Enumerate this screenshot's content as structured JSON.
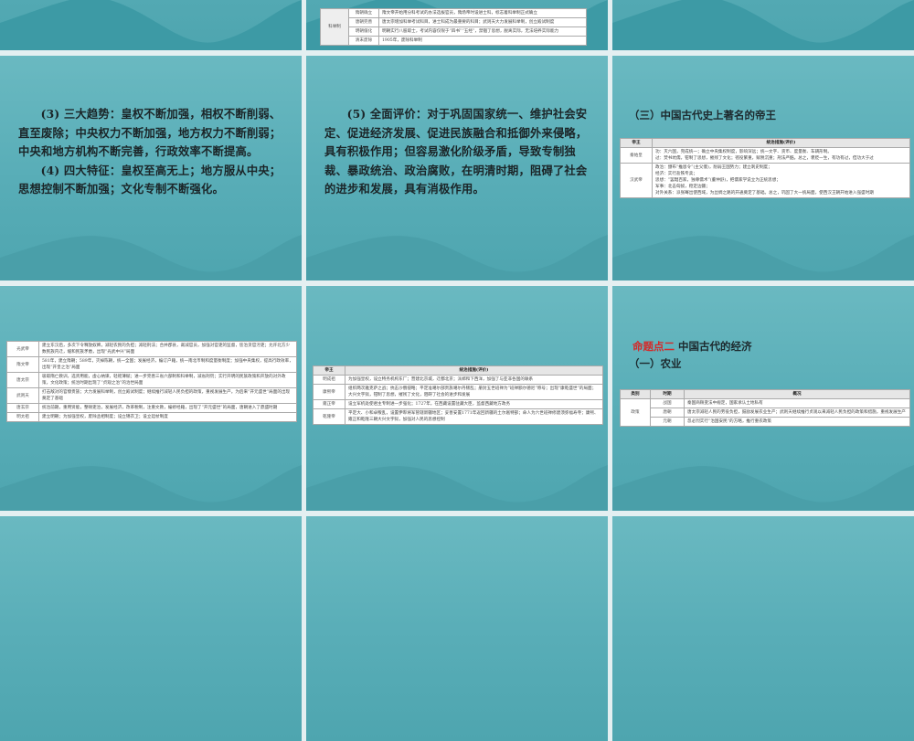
{
  "slides_top": {
    "middle_table": {
      "rows": [
        {
          "group": "科举制",
          "period": "隋朝确立",
          "text": "隋文帝开始用分科考试的办法选拔官员，隋炀帝时设进士科，标志着科举制正式确立"
        },
        {
          "period": "唐朝完善",
          "text": "唐太宗增加科举考试科目，进士科成为最重要的科目；武则天大力发展科举制，创立殿试制度"
        },
        {
          "period": "明朝僵化",
          "text": "明朝实行八股取士，考试内容仅限于“四书”“五经”，禁锢了思想，脱离实际，无法培养实际能力"
        },
        {
          "period": "清末废除",
          "text": "1905年，废除科举制"
        }
      ]
    }
  },
  "slide_trends": {
    "paragraphs": [
      "(3) 三大趋势：皇权不断加强，相权不断削弱、直至废除；中央权力不断加强，地方权力不断削弱；中央和地方机构不断完善，行政效率不断提高。",
      "(4) 四大特征：皇权至高无上；地方服从中央；思想控制不断加强；文化专制不断强化。"
    ]
  },
  "slide_evaluation": {
    "paragraphs": [
      "(5) 全面评价：对于巩固国家统一、维护社会安定、促进经济发展、促进民族融合和抵御外来侵略，具有积极作用；但容易激化阶级矛盾，导致专制独裁、暴政统治、政治腐败，在明清时期，阻碍了社会的进步和发展，具有消极作用。"
    ]
  },
  "slide_emperors": {
    "heading": "（三）中国古代史上著名的帝王",
    "headers": [
      "帝王",
      "统治措施(评价)"
    ],
    "rows": [
      {
        "name": "秦始皇",
        "lines": [
          "功：灭六国，完成统一；确立中央集权制度，影响深远；统一文字、货币、度量衡、车辆形制。",
          "过：焚书坑儒，钳制了思想，摧残了文化；徭役繁重，赋税沉重；刑法严酷。总之，褒贬一生，有功有过，但功大于过"
        ]
      },
      {
        "name": "汉武帝",
        "lines": [
          "政治：颁布“推恩令”(主父偃)，削弱王国势力；建立刺史制度；",
          "经济：实行盐铁专卖；",
          "思想：“罢黜百家，独尊儒术”(董仲舒)，把儒家学说立为正统思想；",
          "军事：北击匈奴，稳定边疆；",
          "对外关系：派张骞出使西域，为丝绸之路的开通奠定了基础。总之，巩固了大一统局面，使西汉王朝开始进入强盛时期"
        ]
      }
    ]
  },
  "slide_emperors2": {
    "rows": [
      {
        "name": "光武帝",
        "text": "建立东汉后，多次下令释放奴婢，减轻农民的负担；减轻刑法；合并郡县，裁减官员，加强对官吏的监督，惩治贪官污吏；允许北方少数民族内迁，缓和民族矛盾，出现“光武中兴”局面"
      },
      {
        "name": "隋文帝",
        "text": "581年，建立隋朝；589年，灭掉陈朝，统一全国；发展经济，编订户籍，统一南北币制和度量衡制度；加强中央集权，提高行政效率，出现“开皇之治”局面"
      },
      {
        "name": "唐太宗",
        "text": "吸取隋亡教训，选贤用能，虚心纳谏，轻徭薄赋；进一步完善三省六部制和科举制，减省刑罚；实行开明的民族政策和开放的对外政策，文化政策；统治时期出现了“贞观之治”的治世局面"
      },
      {
        "name": "武则天",
        "text": "打击敌对的官僚贵族；大力发展科举制，创立殿试制度；继续推行减轻人民负担的政策，重视发展生产。为后来“开元盛世”局面的出现奠定了基础"
      },
      {
        "name": "唐玄宗",
        "text": "统治前期，重用贤能，整顿吏治，发展经济，改革税制，注重文教，编修经籍，出现了“开元盛世”的局面，唐朝进入了鼎盛时期"
      },
      {
        "name": "明太祖",
        "text": "建立明朝；为加强皇权，废除丞相制度；设立锦衣卫；设立廷杖制度"
      }
    ]
  },
  "slide_emperors3": {
    "headers": [
      "帝王",
      "统治措施(评价)"
    ],
    "rows": [
      {
        "name": "明成祖",
        "text": "为加强皇权，设立特务机构东厂；营建北京城，迁都北京；派郑和下西洋，加强了与亚非各国的联系"
      },
      {
        "name": "康熙帝",
        "text": "组织两次雅克萨之战；抗击沙俄侵略；平定准噶尔部贵族噶尔丹叛乱；册封五世班禅为“班禅额尔德尼”称号；出现“康乾盛世”的局面；大兴文字狱，钳制了思想，摧残了文化，阻碍了社会的进步和发展"
      },
      {
        "name": "雍正帝",
        "text": "设立军机处使君主专制进一步强化；1727年，在西藏设置驻藏大臣，监督西藏地方政务"
      },
      {
        "name": "乾隆帝",
        "text": "平定大、小和卓叛乱，设置伊犁将军管辖新疆地区；妥善安置1771年返回新疆的土尔扈特部；命人为六世班禅修建须弥福寿寺；康熙、雍正和乾隆三朝大兴文字狱，加强对人民的思想控制"
      }
    ]
  },
  "slide_economy": {
    "topic_label": "命题点二",
    "topic_title": "中国古代的经济",
    "subheading": "（一）农业",
    "headers": [
      "类别",
      "时期",
      "概况"
    ],
    "group": "政策",
    "rows": [
      {
        "period": "战国",
        "text": "秦国商鞅变法中规定，国家承认土地私有"
      },
      {
        "period": "唐朝",
        "text": "唐太宗减轻人民的劳役负担，鼓励发展农业生产；武则天继续推行贞观以来减轻人民负担的政策和措施，重视发展生产"
      },
      {
        "period": "元朝",
        "text": "忽必烈实行“治国安民”的方略，推行重农政策"
      }
    ]
  },
  "colors": {
    "slide_bg": "#58adb7",
    "wave": "#3d9aa5",
    "accent_red": "#d42a2a",
    "gap": "#e4eff1"
  }
}
